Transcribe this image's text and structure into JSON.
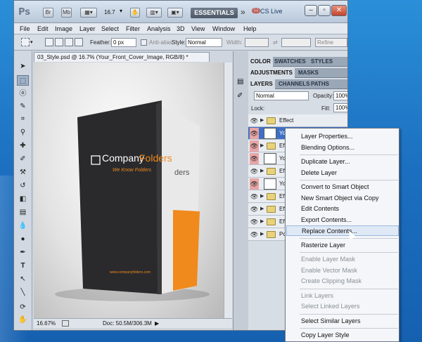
{
  "app": {
    "logo": "Ps",
    "tb_buttons": [
      "Br",
      "Mb"
    ],
    "zoom": "16.7",
    "workspace": "ESSENTIALS",
    "more": "»",
    "cslive": "CS Live"
  },
  "menus": [
    "File",
    "Edit",
    "Image",
    "Layer",
    "Select",
    "Filter",
    "Analysis",
    "3D",
    "View",
    "Window",
    "Help"
  ],
  "options": {
    "feather_label": "Feather:",
    "feather_value": "0 px",
    "antialias_label": "Anti-alias",
    "style_label": "Style:",
    "style_value": "Normal",
    "width_label": "Width:",
    "height_label": "Height:",
    "refine_label": "Refine"
  },
  "document": {
    "tab_title": "03_Style.psd @ 16.7% (Your_Front_Cover_Image, RGB/8) *",
    "zoom_status": "16.67%",
    "doc_status": "Doc: 50.5M/306.3M"
  },
  "artwork": {
    "brand_a": "Company",
    "brand_b": "Folders",
    "tagline": "We Know Folders",
    "url": "www.companyfolders.com",
    "inner_text": "ders"
  },
  "panels": {
    "tabs_row1": [
      "COLOR",
      "SWATCHES",
      "STYLES"
    ],
    "tabs_row2": [
      "ADJUSTMENTS",
      "MASKS"
    ],
    "tabs_row3": [
      "LAYERS",
      "CHANNELS",
      "PATHS"
    ],
    "blend_mode": "Normal",
    "opacity_label": "Opacity:",
    "opacity_value": "100%",
    "lock_label": "Lock:",
    "fill_label": "Fill:",
    "fill_value": "100%"
  },
  "layers": [
    {
      "name": "Effect",
      "type": "folder",
      "eye": false
    },
    {
      "name": "Your",
      "type": "layer",
      "eye": true,
      "selected": true
    },
    {
      "name": "Effe",
      "type": "folder",
      "eye": true
    },
    {
      "name": "Your_",
      "type": "layer",
      "eye": true
    },
    {
      "name": "Effe",
      "type": "folder",
      "eye": false
    },
    {
      "name": "Your",
      "type": "layer",
      "eye": true
    },
    {
      "name": "Effe",
      "type": "folder",
      "eye": false
    },
    {
      "name": "Effe",
      "type": "folder",
      "eye": false
    },
    {
      "name": "Effe",
      "type": "folder",
      "eye": false
    },
    {
      "name": "Pock",
      "type": "folder",
      "eye": false
    }
  ],
  "context_menu": [
    {
      "label": "Layer Properties...",
      "enabled": true
    },
    {
      "label": "Blending Options...",
      "enabled": true
    },
    {
      "sep": true
    },
    {
      "label": "Duplicate Layer...",
      "enabled": true
    },
    {
      "label": "Delete Layer",
      "enabled": true
    },
    {
      "sep": true
    },
    {
      "label": "Convert to Smart Object",
      "enabled": true
    },
    {
      "label": "New Smart Object via Copy",
      "enabled": true
    },
    {
      "label": "Edit Contents",
      "enabled": true
    },
    {
      "label": "Export Contents...",
      "enabled": true
    },
    {
      "label": "Replace Contents...",
      "enabled": true,
      "highlight": true
    },
    {
      "sep": true
    },
    {
      "label": "Rasterize Layer",
      "enabled": true
    },
    {
      "sep": true
    },
    {
      "label": "Enable Layer Mask",
      "enabled": false
    },
    {
      "label": "Enable Vector Mask",
      "enabled": false
    },
    {
      "label": "Create Clipping Mask",
      "enabled": false
    },
    {
      "sep": true
    },
    {
      "label": "Link Layers",
      "enabled": false
    },
    {
      "label": "Select Linked Layers",
      "enabled": false
    },
    {
      "sep": true
    },
    {
      "label": "Select Similar Layers",
      "enabled": true
    },
    {
      "sep": true
    },
    {
      "label": "Copy Layer Style",
      "enabled": true
    }
  ],
  "colors": {
    "accent_orange": "#f08a1c",
    "folder_dark": "#2a2a2c",
    "selection_blue": "#3f6fc5"
  }
}
